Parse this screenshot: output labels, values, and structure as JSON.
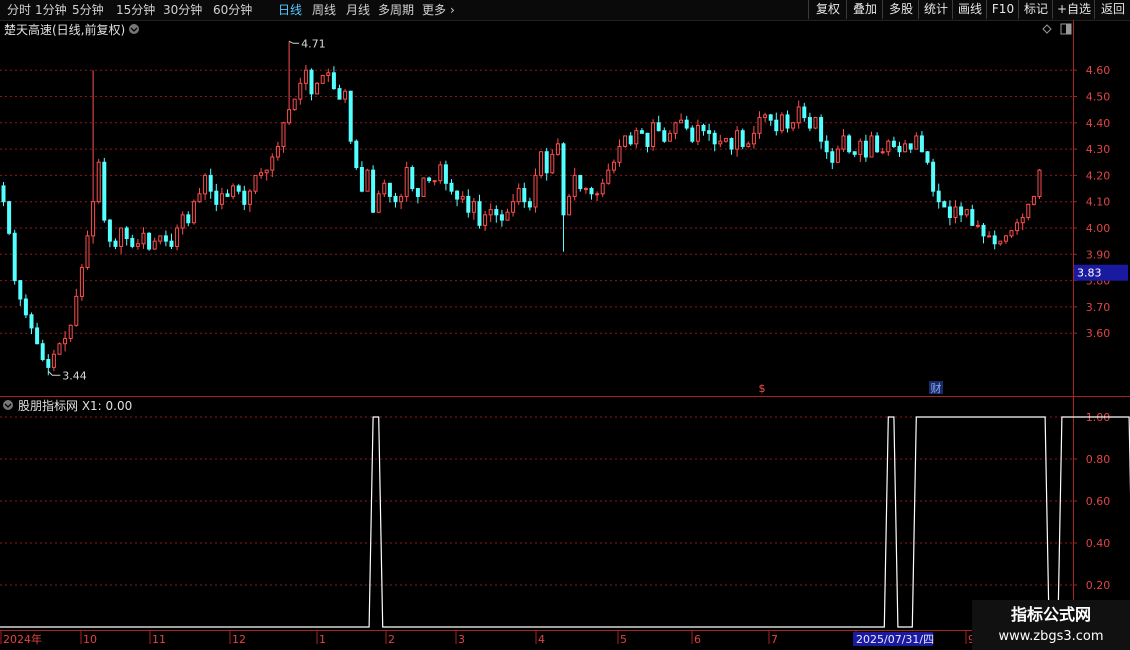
{
  "toolbar": {
    "periods": [
      {
        "label": "分时",
        "active": false
      },
      {
        "label": "1分钟",
        "active": false
      },
      {
        "label": "5分钟",
        "active": false
      },
      {
        "label": "15分钟",
        "active": false
      },
      {
        "label": "30分钟",
        "active": false
      },
      {
        "label": "60分钟",
        "active": false
      },
      {
        "label": "日线",
        "active": true
      },
      {
        "label": "周线",
        "active": false
      },
      {
        "label": "月线",
        "active": false
      },
      {
        "label": "多周期",
        "active": false
      },
      {
        "label": "更多",
        "active": false
      }
    ],
    "more_icon": "chevron-right-icon",
    "buttons": [
      "复权",
      "叠加",
      "多股",
      "统计",
      "画线",
      "F10",
      "标记",
      "+自选",
      "返回"
    ]
  },
  "colors": {
    "rise": "#ff4d4d",
    "fall": "#54ffff",
    "grid": "#8a1a1a",
    "axis_text": "#e04444",
    "panel_border": "#aa2222",
    "price_tag_bg": "#1a1aa0",
    "indicator_line": "#ffffff"
  },
  "price_panel": {
    "title": "楚天高速(日线,前复权)",
    "title_icon": "chevron-down-icon",
    "corner_icons": [
      "diamond-icon",
      "panel-toggle-icon"
    ],
    "y_ticks": [
      "4.60",
      "4.50",
      "4.40",
      "4.30",
      "4.20",
      "4.10",
      "4.00",
      "3.90",
      "3.80",
      "3.70",
      "3.60"
    ],
    "y_min": 3.4,
    "y_max": 4.8,
    "current_price": "3.83",
    "high_label": "4.71",
    "low_label": "3.44",
    "event_markers": [
      {
        "label": "$",
        "color": "#ff4d4d"
      },
      {
        "label": "财",
        "color": "#88aaff"
      }
    ]
  },
  "indicator_panel": {
    "title": "股朋指标网 X1: 0.00",
    "title_icon": "chevron-down-icon",
    "y_ticks": [
      "1.00",
      "0.80",
      "0.60",
      "0.40",
      "0.20"
    ]
  },
  "x_axis": {
    "labels": [
      "2024年",
      "10",
      "11",
      "12",
      "1",
      "2",
      "3",
      "4",
      "5",
      "6",
      "7",
      "8",
      "9"
    ],
    "cursor_date": "2025/07/31/四"
  },
  "watermark": {
    "line1": "指标公式网",
    "line2": "www.zbgs3.com"
  },
  "chart_data": {
    "type": "candlestick",
    "title": "楚天高速(日线,前复权)",
    "x_label_sequence": [
      "2024年",
      "10",
      "11",
      "12",
      "1",
      "2",
      "3",
      "4",
      "5",
      "6",
      "7",
      "8",
      "9"
    ],
    "close_series": [
      4.1,
      3.98,
      3.8,
      3.73,
      3.67,
      3.62,
      3.56,
      3.5,
      3.47,
      3.52,
      3.56,
      3.58,
      3.63,
      3.74,
      3.85,
      3.97,
      4.1,
      4.25,
      4.03,
      3.95,
      3.93,
      4.0,
      3.96,
      3.93,
      3.94,
      3.98,
      3.92,
      3.95,
      3.97,
      3.95,
      3.93,
      4.0,
      4.05,
      4.02,
      4.1,
      4.13,
      4.2,
      4.14,
      4.09,
      4.13,
      4.12,
      4.16,
      4.14,
      4.09,
      4.14,
      4.2,
      4.21,
      4.22,
      4.27,
      4.31,
      4.4,
      4.45,
      4.49,
      4.55,
      4.6,
      4.51,
      4.55,
      4.58,
      4.59,
      4.53,
      4.49,
      4.52,
      4.33,
      4.23,
      4.14,
      4.22,
      4.06,
      4.13,
      4.17,
      4.12,
      4.1,
      4.12,
      4.23,
      4.15,
      4.12,
      4.19,
      4.18,
      4.18,
      4.24,
      4.17,
      4.14,
      4.11,
      4.12,
      4.06,
      4.1,
      4.01,
      4.05,
      4.07,
      4.05,
      4.03,
      4.06,
      4.1,
      4.15,
      4.1,
      4.08,
      4.2,
      4.29,
      4.21,
      4.28,
      4.32,
      4.05,
      4.12,
      4.2,
      4.15,
      4.15,
      4.13,
      4.13,
      4.17,
      4.22,
      4.25,
      4.31,
      4.35,
      4.32,
      4.37,
      4.36,
      4.31,
      4.4,
      4.37,
      4.33,
      4.36,
      4.4,
      4.41,
      4.38,
      4.33,
      4.39,
      4.37,
      4.36,
      4.32,
      4.33,
      4.34,
      4.3,
      4.37,
      4.31,
      4.32,
      4.36,
      4.42,
      4.43,
      4.41,
      4.37,
      4.43,
      4.38,
      4.4,
      4.46,
      4.42,
      4.38,
      4.42,
      4.33,
      4.29,
      4.25,
      4.3,
      4.35,
      4.29,
      4.28,
      4.33,
      4.27,
      4.35,
      4.29,
      4.29,
      4.33,
      4.31,
      4.29,
      4.32,
      4.3,
      4.35,
      4.29,
      4.25,
      4.14,
      4.1,
      4.08,
      4.04,
      4.08,
      4.05,
      4.07,
      4.01,
      4.01,
      3.97,
      3.97,
      3.94,
      3.95,
      3.97,
      3.99,
      4.02,
      4.04,
      4.09,
      4.12,
      4.22
    ],
    "high": 4.71,
    "low": 3.44,
    "last_price": 3.83,
    "y_axis_ticks": [
      4.6,
      4.5,
      4.4,
      4.3,
      4.2,
      4.1,
      4.0,
      3.9,
      3.8,
      3.7,
      3.6
    ],
    "indicator": {
      "name": "X1",
      "value_shown": 0.0,
      "type": "line",
      "ylim": [
        0,
        1
      ],
      "y_axis_ticks": [
        1.0,
        0.8,
        0.6,
        0.4,
        0.2
      ],
      "high_segments_by_bar_index": [
        [
          66,
          67
        ],
        [
          158,
          159
        ],
        [
          163,
          186
        ],
        [
          189,
          201
        ]
      ]
    }
  }
}
